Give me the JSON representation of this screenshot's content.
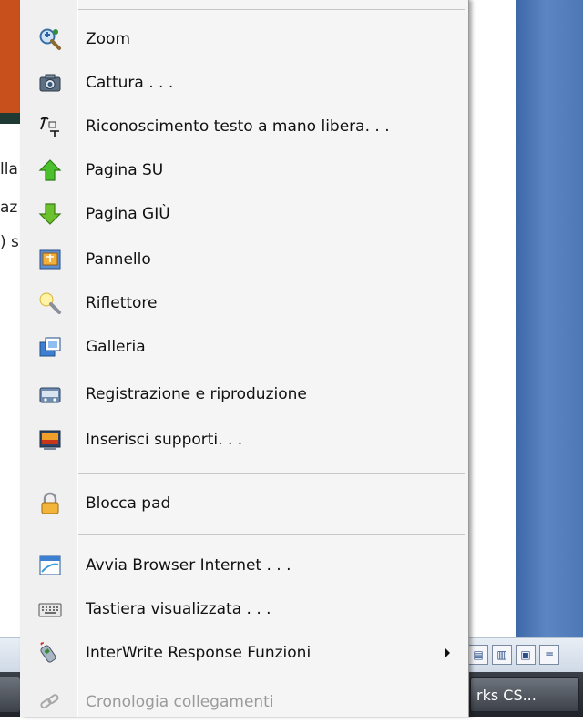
{
  "background": {
    "left_text_lines": [
      "lla",
      "az",
      ") s"
    ],
    "taskbar_button_label": "rks CS..."
  },
  "menu": {
    "items": [
      {
        "label": "Zoom",
        "icon": "zoom-icon"
      },
      {
        "label": "Cattura . . .",
        "icon": "camera-icon"
      },
      {
        "label": "Riconoscimento testo a mano libera. . .",
        "icon": "handwriting-icon"
      },
      {
        "label": "Pagina SU",
        "icon": "arrow-up-icon"
      },
      {
        "label": "Pagina GIÙ",
        "icon": "arrow-down-icon"
      },
      {
        "label": "Pannello",
        "icon": "panel-icon"
      },
      {
        "label": "Riflettore",
        "icon": "spotlight-icon"
      },
      {
        "label": "Galleria",
        "icon": "gallery-icon"
      },
      {
        "label": "Registrazione e riproduzione",
        "icon": "recorder-icon"
      },
      {
        "label": "Inserisci supporti. . .",
        "icon": "media-icon"
      },
      {
        "label": "Blocca pad",
        "icon": "lock-icon"
      },
      {
        "label": "Avvia Browser Internet . . .",
        "icon": "browser-icon"
      },
      {
        "label": "Tastiera visualizzata . . .",
        "icon": "keyboard-icon"
      },
      {
        "label": "InterWrite Response Funzioni",
        "icon": "response-icon",
        "has_submenu": true
      },
      {
        "label": "Cronologia collegamenti",
        "icon": "link-history-icon",
        "disabled": true
      }
    ]
  },
  "colors": {
    "menu_background": "#f5f5f5",
    "disabled_text": "#9a9a9a",
    "desktop_blue": "#4d78b6",
    "taskbar_dark": "#2a2e34"
  }
}
